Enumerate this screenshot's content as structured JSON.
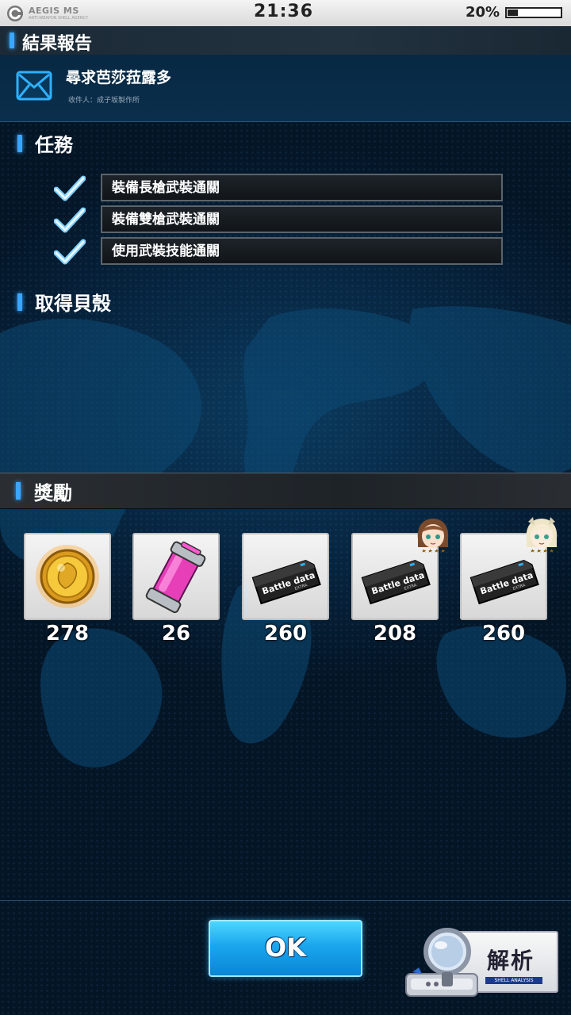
{
  "status_bar": {
    "brand": "AEGIS MS",
    "brand_sub": "ANTI-WEAPON SHELL AGENCY",
    "time": "21:36",
    "battery_text": "20%",
    "battery_level": 0.2
  },
  "header": {
    "title": "結果報告"
  },
  "mail": {
    "subject": "尋求芭莎菈露多",
    "recipient": "收件人：成子坂製作所"
  },
  "tasks_section": {
    "title": "任務",
    "items": [
      {
        "label": "裝備長槍武裝通關",
        "completed": true
      },
      {
        "label": "裝備雙槍武裝通關",
        "completed": true
      },
      {
        "label": "使用武裝技能通關",
        "completed": true
      }
    ]
  },
  "shell_section": {
    "title": "取得貝殼"
  },
  "rewards_section": {
    "title": "獎勵",
    "items": [
      {
        "icon": "gold-coin-icon",
        "count": "278"
      },
      {
        "icon": "energy-canister-icon",
        "count": "26"
      },
      {
        "icon": "battle-data-card-icon",
        "count": "260",
        "card_text": "Battle data",
        "card_sub": "EXTRA"
      },
      {
        "icon": "battle-data-card-icon",
        "count": "208",
        "card_text": "Battle data",
        "card_sub": "EXTRA",
        "character": "brown-hair-girl-avatar"
      },
      {
        "icon": "battle-data-card-icon",
        "count": "260",
        "card_text": "Battle data",
        "card_sub": "EXTRA",
        "character": "blonde-girl-avatar"
      }
    ]
  },
  "footer": {
    "ok_label": "OK",
    "analysis_label": "解析",
    "analysis_sub": "SHELL ANALYSIS"
  },
  "colors": {
    "accent": "#3aa6ff",
    "ok_button": "#1aa6ee",
    "background": "#041526"
  }
}
